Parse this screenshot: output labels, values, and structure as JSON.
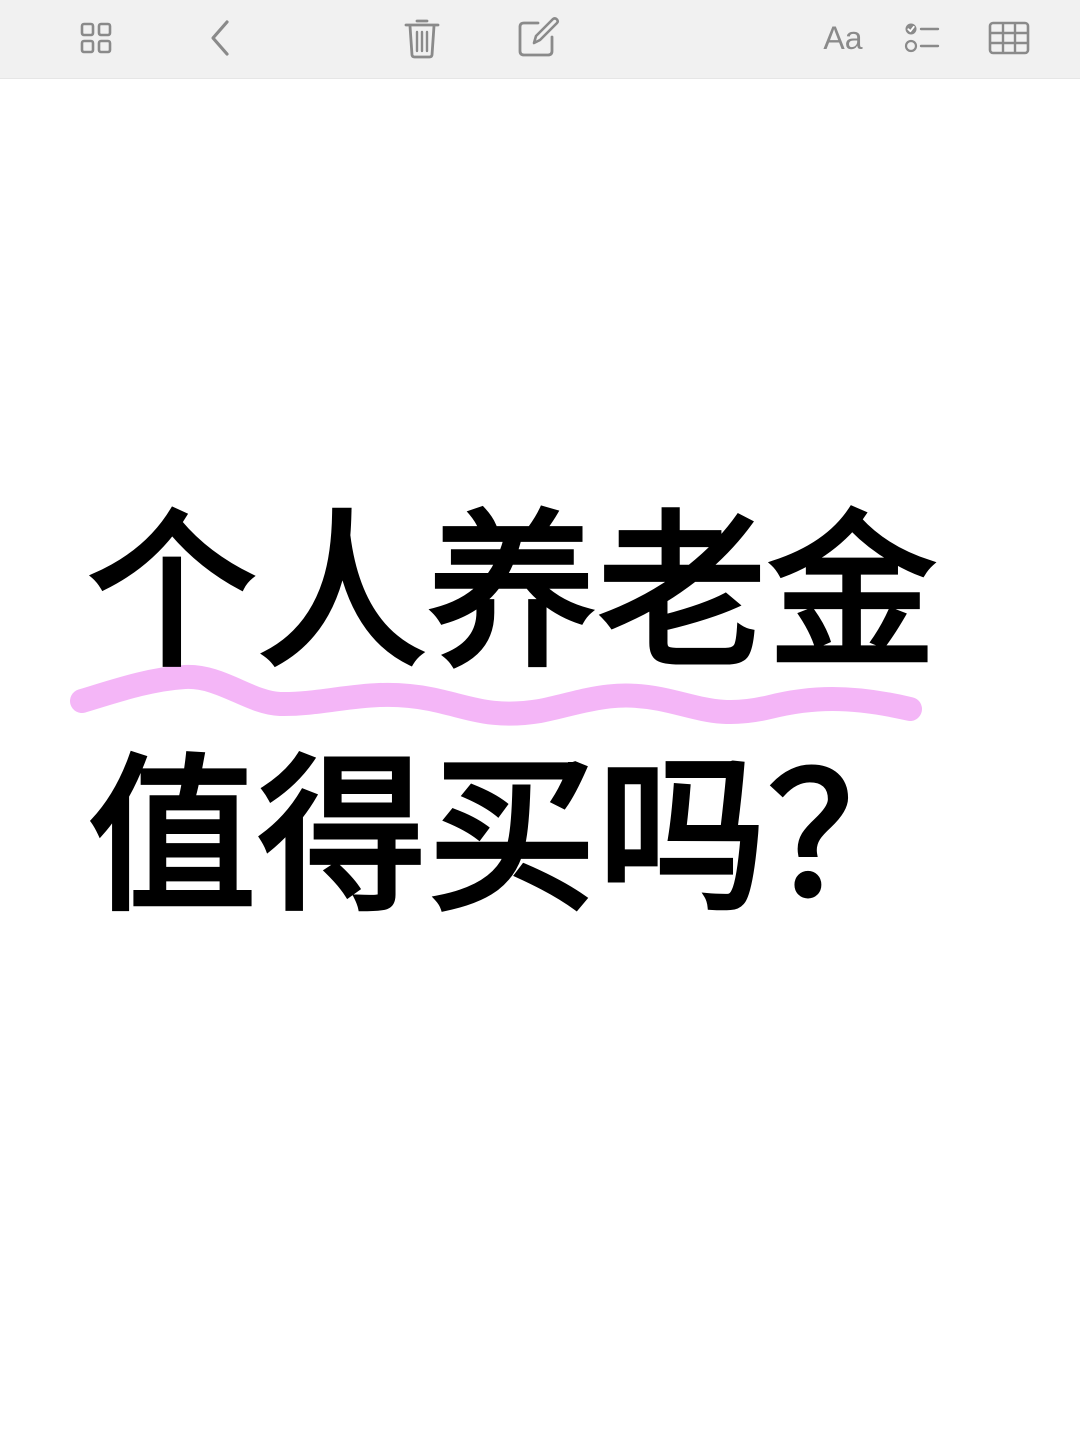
{
  "toolbar": {
    "items": [
      {
        "name": "grid-view-icon"
      },
      {
        "name": "back-icon"
      },
      {
        "name": "trash-icon"
      },
      {
        "name": "compose-icon"
      },
      {
        "name": "format-text-button",
        "label": "Aa"
      },
      {
        "name": "checklist-icon"
      },
      {
        "name": "table-icon"
      }
    ],
    "icon_color": "#8a8a8a",
    "background": "#f1f1f1"
  },
  "note": {
    "line1": "个人养老金",
    "line2": "值得买吗？",
    "text_color": "#000000",
    "underline_color": "#f4b6f7"
  }
}
